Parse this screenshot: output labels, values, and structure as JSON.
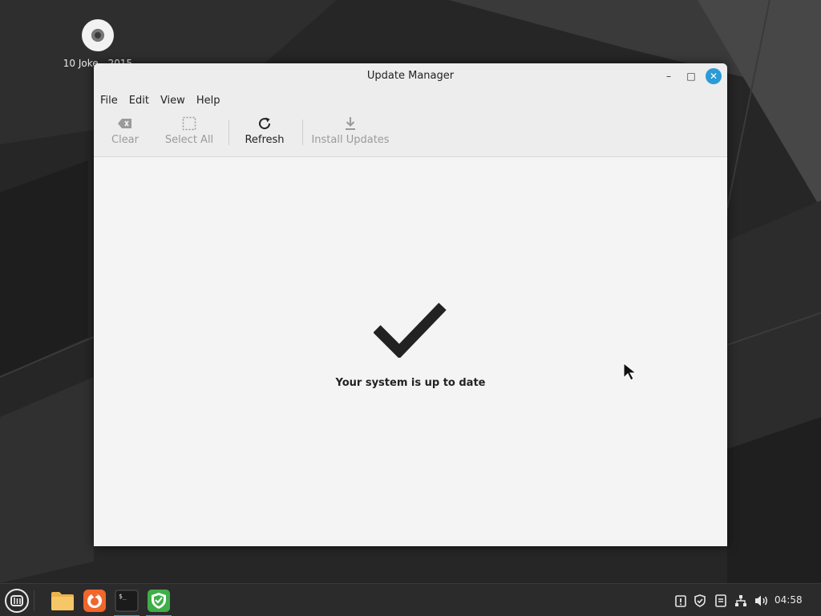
{
  "desktop": {
    "icon_label": "10 Joke__2015"
  },
  "window": {
    "title": "Update Manager",
    "controls": {
      "minimize_glyph": "–",
      "maximize_glyph": "□",
      "close_glyph": "✕"
    }
  },
  "menubar": {
    "items": [
      "File",
      "Edit",
      "View",
      "Help"
    ]
  },
  "toolbar": {
    "clear_label": "Clear",
    "select_all_label": "Select All",
    "refresh_label": "Refresh",
    "install_label": "Install Updates",
    "clear_enabled": false,
    "select_all_enabled": false,
    "refresh_enabled": true,
    "install_enabled": false
  },
  "content": {
    "status_message": "Your system is up to date",
    "status_icon": "checkmark-icon"
  },
  "taskbar": {
    "clock": "04:58",
    "apps": [
      "menu-icon",
      "files-icon",
      "firefox-icon",
      "terminal-icon",
      "update-manager-icon"
    ],
    "tray": [
      "clipboard-icon",
      "shield-icon",
      "notes-icon",
      "network-icon",
      "volume-icon"
    ]
  },
  "colors": {
    "accent": "#2b9bd6",
    "panel": "#2b2b2b",
    "window_bg": "#f4f4f4",
    "shield_green": "#3fae49"
  }
}
